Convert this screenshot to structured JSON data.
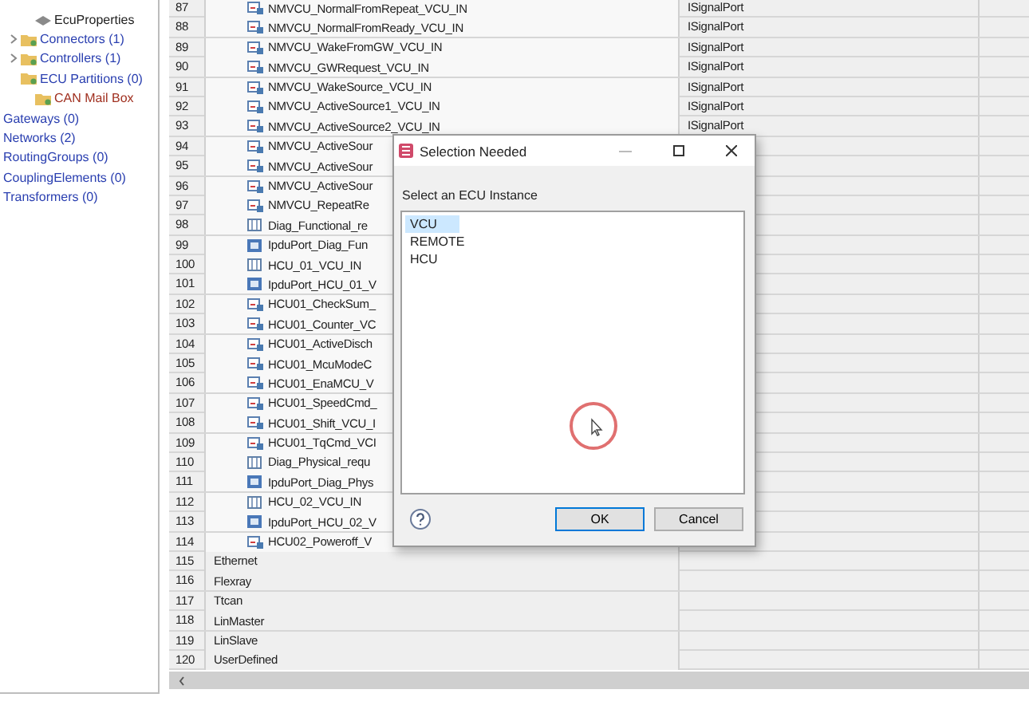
{
  "tree": {
    "items": [
      {
        "label": "EcuProperties",
        "kind": "properties",
        "expandable": false
      },
      {
        "label": "Connectors (1)",
        "kind": "folder",
        "expandable": true
      },
      {
        "label": "Controllers (1)",
        "kind": "folder",
        "expandable": true
      },
      {
        "label": "ECU Partitions (0)",
        "kind": "folder",
        "expandable": false
      },
      {
        "label": "CAN Mail Box",
        "kind": "mailbox",
        "expandable": false
      },
      {
        "label": "Gateways (0)",
        "kind": "root",
        "expandable": false
      },
      {
        "label": "Networks (2)",
        "kind": "root",
        "expandable": false
      },
      {
        "label": "RoutingGroups (0)",
        "kind": "root",
        "expandable": false
      },
      {
        "label": "CouplingElements (0)",
        "kind": "root",
        "expandable": false
      },
      {
        "label": "Transformers (0)",
        "kind": "root",
        "expandable": false
      }
    ]
  },
  "table": {
    "rows": [
      {
        "number": "87",
        "name": "NMVCU_NormalFromRepeat_VCU_IN",
        "kind": "signal",
        "type": "ISignalPort"
      },
      {
        "number": "88",
        "name": "NMVCU_NormalFromReady_VCU_IN",
        "kind": "signal",
        "type": "ISignalPort"
      },
      {
        "number": "89",
        "name": "NMVCU_WakeFromGW_VCU_IN",
        "kind": "signal",
        "type": "ISignalPort"
      },
      {
        "number": "90",
        "name": "NMVCU_GWRequest_VCU_IN",
        "kind": "signal",
        "type": "ISignalPort"
      },
      {
        "number": "91",
        "name": "NMVCU_WakeSource_VCU_IN",
        "kind": "signal",
        "type": "ISignalPort"
      },
      {
        "number": "92",
        "name": "NMVCU_ActiveSource1_VCU_IN",
        "kind": "signal",
        "type": "ISignalPort"
      },
      {
        "number": "93",
        "name": "NMVCU_ActiveSource2_VCU_IN",
        "kind": "signal",
        "type": "ISignalPort"
      },
      {
        "number": "94",
        "name": "NMVCU_ActiveSour",
        "kind": "signal"
      },
      {
        "number": "95",
        "name": "NMVCU_ActiveSour",
        "kind": "signal"
      },
      {
        "number": "96",
        "name": "NMVCU_ActiveSour",
        "kind": "signal"
      },
      {
        "number": "97",
        "name": "NMVCU_RepeatRe",
        "kind": "signal"
      },
      {
        "number": "98",
        "name": "Diag_Functional_re",
        "kind": "pdu"
      },
      {
        "number": "99",
        "name": "IpduPort_Diag_Fun",
        "kind": "port"
      },
      {
        "number": "100",
        "name": "HCU_01_VCU_IN",
        "kind": "pdu"
      },
      {
        "number": "101",
        "name": "IpduPort_HCU_01_V",
        "kind": "port"
      },
      {
        "number": "102",
        "name": "HCU01_CheckSum_",
        "kind": "signal"
      },
      {
        "number": "103",
        "name": "HCU01_Counter_VC",
        "kind": "signal"
      },
      {
        "number": "104",
        "name": "HCU01_ActiveDisch",
        "kind": "signal"
      },
      {
        "number": "105",
        "name": "HCU01_McuModeC",
        "kind": "signal"
      },
      {
        "number": "106",
        "name": "HCU01_EnaMCU_V",
        "kind": "signal"
      },
      {
        "number": "107",
        "name": "HCU01_SpeedCmd_",
        "kind": "signal"
      },
      {
        "number": "108",
        "name": "HCU01_Shift_VCU_I",
        "kind": "signal"
      },
      {
        "number": "109",
        "name": "HCU01_TqCmd_VCI",
        "kind": "signal"
      },
      {
        "number": "110",
        "name": "Diag_Physical_requ",
        "kind": "pdu"
      },
      {
        "number": "111",
        "name": "IpduPort_Diag_Phys",
        "kind": "port"
      },
      {
        "number": "112",
        "name": "HCU_02_VCU_IN",
        "kind": "pdu"
      },
      {
        "number": "113",
        "name": "IpduPort_HCU_02_V",
        "kind": "port"
      },
      {
        "number": "114",
        "name": "HCU02_Poweroff_V",
        "kind": "signal"
      },
      {
        "number": "115",
        "name": "Ethernet",
        "kind": "group"
      },
      {
        "number": "116",
        "name": "Flexray",
        "kind": "group"
      },
      {
        "number": "117",
        "name": "Ttcan",
        "kind": "group"
      },
      {
        "number": "118",
        "name": "LinMaster",
        "kind": "group"
      },
      {
        "number": "119",
        "name": "LinSlave",
        "kind": "group"
      },
      {
        "number": "120",
        "name": "UserDefined",
        "kind": "group"
      }
    ]
  },
  "dialog": {
    "title": "Selection Needed",
    "prompt": "Select an ECU Instance",
    "options": [
      {
        "label": "VCU",
        "selected": true
      },
      {
        "label": "REMOTE",
        "selected": false
      },
      {
        "label": "HCU",
        "selected": false
      }
    ],
    "buttons": [
      {
        "label": "OK",
        "default": true
      },
      {
        "label": "Cancel",
        "default": false
      }
    ]
  }
}
